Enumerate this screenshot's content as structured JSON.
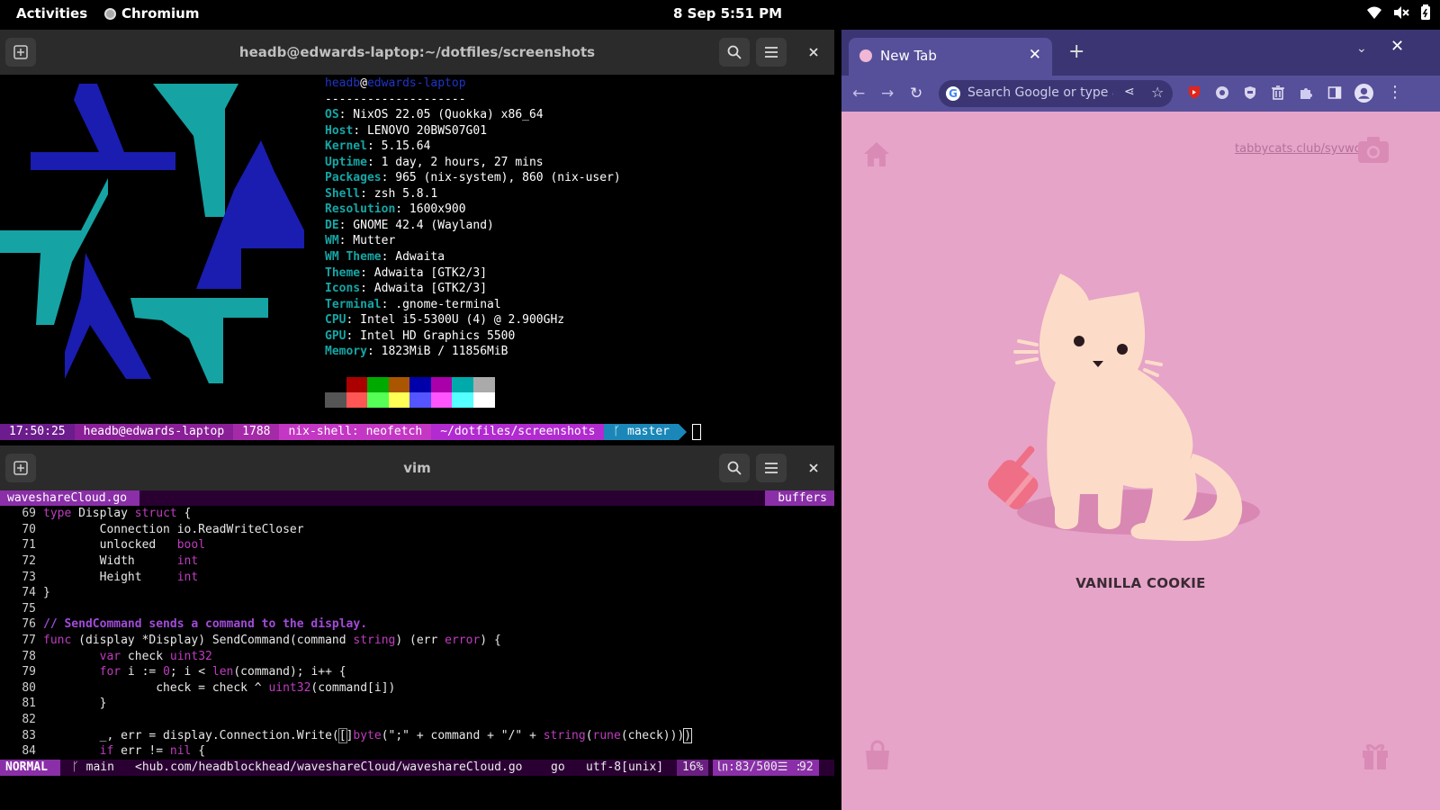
{
  "topbar": {
    "activities": "Activities",
    "app": "Chromium",
    "clock": "8 Sep  5:51 PM"
  },
  "terminal1": {
    "title": "headb@edwards-laptop:~/dotfiles/screenshots",
    "neofetch": {
      "user": "headb",
      "at": "@",
      "host": "edwards-laptop",
      "sep": "--------------------",
      "rows": [
        {
          "k": "OS",
          "v": ": NixOS 22.05 (Quokka) x86_64"
        },
        {
          "k": "Host",
          "v": ": LENOVO 20BWS07G01"
        },
        {
          "k": "Kernel",
          "v": ": 5.15.64"
        },
        {
          "k": "Uptime",
          "v": ": 1 day, 2 hours, 27 mins"
        },
        {
          "k": "Packages",
          "v": ": 965 (nix-system), 860 (nix-user)"
        },
        {
          "k": "Shell",
          "v": ": zsh 5.8.1"
        },
        {
          "k": "Resolution",
          "v": ": 1600x900"
        },
        {
          "k": "DE",
          "v": ": GNOME 42.4 (Wayland)"
        },
        {
          "k": "WM",
          "v": ": Mutter"
        },
        {
          "k": "WM Theme",
          "v": ": Adwaita"
        },
        {
          "k": "Theme",
          "v": ": Adwaita [GTK2/3]"
        },
        {
          "k": "Icons",
          "v": ": Adwaita [GTK2/3]"
        },
        {
          "k": "Terminal",
          "v": ": .gnome-terminal"
        },
        {
          "k": "CPU",
          "v": ": Intel i5-5300U (4) @ 2.900GHz"
        },
        {
          "k": "GPU",
          "v": ": Intel HD Graphics 5500"
        },
        {
          "k": "Memory",
          "v": ": 1823MiB / 11856MiB"
        }
      ],
      "palette_top": [
        "#000000",
        "#aa0000",
        "#00aa00",
        "#aa5500",
        "#0000aa",
        "#aa00aa",
        "#00aaaa",
        "#aaaaaa"
      ],
      "palette_bottom": [
        "#555555",
        "#ff5555",
        "#55ff55",
        "#ffff55",
        "#5555ff",
        "#ff55ff",
        "#55ffff",
        "#ffffff"
      ]
    },
    "prompt": {
      "time": "17:50:25",
      "userhost": "headb@edwards-laptop",
      "num": "1788",
      "shell": "nix-shell: neofetch",
      "path": "~/dotfiles/screenshots",
      "branch": "ᚴ master"
    }
  },
  "terminal2": {
    "title": "vim",
    "tab_file": "waveshareCloud.go",
    "tab_buffers": "buffers",
    "status": {
      "mode": "NORMAL",
      "branch": "ᚴ main",
      "path": "<hub.com/headblockhead/waveshareCloud/waveshareCloud.go",
      "ft": "go",
      "enc": "utf-8[unix]",
      "pct": "16%",
      "pos": "㏑:83/500☰ :2",
      "count": "92"
    }
  },
  "browser": {
    "tab_title": "New Tab",
    "omnibox_placeholder": "Search Google or type a URL",
    "short_link": "tabbycats.club/syvwcl",
    "cat_name": "VANILLA COOKIE"
  }
}
